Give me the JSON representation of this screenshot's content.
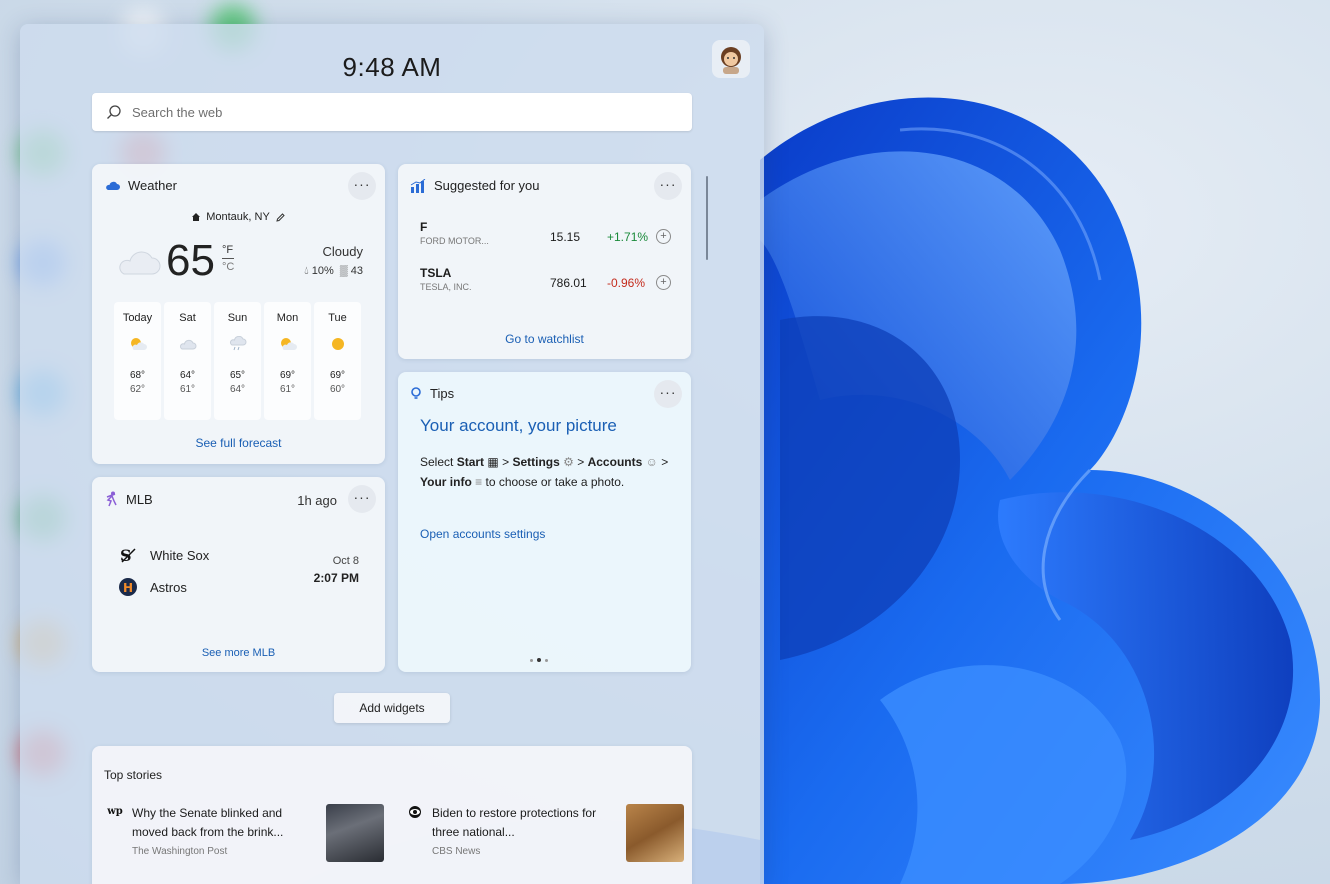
{
  "clock": {
    "time": "9:48 AM"
  },
  "search": {
    "placeholder": "Search the web"
  },
  "weather": {
    "title": "Weather",
    "location": "Montauk, NY",
    "temperature": "65",
    "unit_f": "°F",
    "unit_c": "°C",
    "condition": "Cloudy",
    "precip": "10%",
    "aqi": "43",
    "forecast": [
      {
        "day": "Today",
        "icon": "sun-cloud-icon",
        "hi": "68°",
        "lo": "62°"
      },
      {
        "day": "Sat",
        "icon": "cloud-icon",
        "hi": "64°",
        "lo": "61°"
      },
      {
        "day": "Sun",
        "icon": "rain-cloud-icon",
        "hi": "65°",
        "lo": "64°"
      },
      {
        "day": "Mon",
        "icon": "sun-cloud-icon",
        "hi": "69°",
        "lo": "61°"
      },
      {
        "day": "Tue",
        "icon": "sun-icon",
        "hi": "69°",
        "lo": "60°"
      }
    ],
    "link": "See full forecast"
  },
  "stocks": {
    "title": "Suggested for you",
    "items": [
      {
        "symbol": "F",
        "name": "FORD MOTOR...",
        "price": "15.15",
        "change": "+1.71%",
        "direction": "up",
        "color": "#1a8a3a"
      },
      {
        "symbol": "TSLA",
        "name": "TESLA, INC.",
        "price": "786.01",
        "change": "-0.96%",
        "direction": "down",
        "color": "#c42b1c"
      }
    ],
    "link": "Go to watchlist"
  },
  "tips": {
    "title": "Tips",
    "headline": "Your account, your picture",
    "body": {
      "select": "Select",
      "start": "Start",
      "gt1": ">",
      "settings": "Settings",
      "gt2": ">",
      "accounts": "Accounts",
      "gt3": ">",
      "your_info": "Your info",
      "rest": "to choose or take a photo."
    },
    "link": "Open accounts settings"
  },
  "mlb": {
    "title": "MLB",
    "time_ago": "1h ago",
    "teams": [
      "White Sox",
      "Astros"
    ],
    "date": "Oct 8",
    "time": "2:07 PM",
    "link": "See more MLB"
  },
  "add_widgets": "Add widgets",
  "top_stories": {
    "title": "Top stories",
    "items": [
      {
        "headline": "Why the Senate blinked and moved back from the brink...",
        "source": "The Washington Post",
        "source_icon": "wp-icon"
      },
      {
        "headline": "Biden to restore protections for three national...",
        "source": "CBS News",
        "source_icon": "cbs-eye-icon"
      }
    ]
  },
  "colors": {
    "accent": "#1a5fb4",
    "positive": "#1a8a3a",
    "negative": "#c42b1c"
  }
}
